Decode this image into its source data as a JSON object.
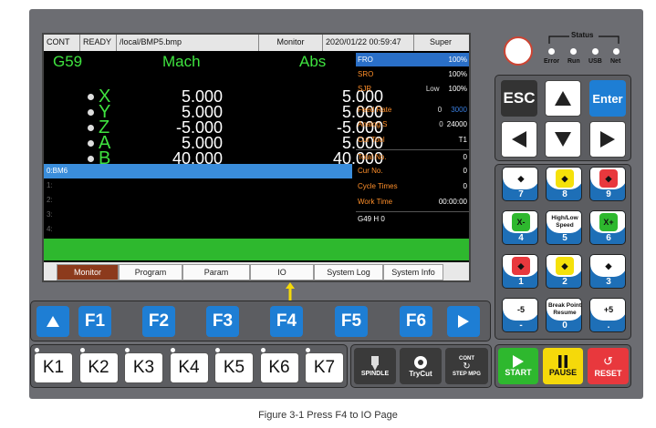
{
  "status_bar": {
    "cont": "CONT",
    "ready": "READY",
    "file": "/local/BMP5.bmp",
    "mode": "Monitor",
    "datetime": "2020/01/22 00:59:47",
    "user": "Super"
  },
  "coords": {
    "wcs": "G59",
    "mach_label": "Mach",
    "abs_label": "Abs",
    "axes": [
      {
        "name": "X",
        "mach": "5.000",
        "abs": "5.000"
      },
      {
        "name": "Y",
        "mach": "5.000",
        "abs": "5.000"
      },
      {
        "name": "Z",
        "mach": "-5.000",
        "abs": "-5.000"
      },
      {
        "name": "A",
        "mach": "5.000",
        "abs": "5.000"
      },
      {
        "name": "B",
        "mach": "40.000",
        "abs": "40.000"
      }
    ]
  },
  "right_panel": {
    "fro_label": "FRO",
    "fro": "100%",
    "sro_label": "SRO",
    "sro": "100%",
    "sjr_label": "SJR",
    "sjr_mode": "Low",
    "sjr": "100%",
    "feed_label": "Feed Rate",
    "feed_act": "0",
    "feed_set": "3000",
    "analog_label": "Analog S",
    "analog_act": "0",
    "analog_set": "24000",
    "tool_label": "Cur Tool",
    "tool": "T1",
    "total_label": "Total No.",
    "total": "0",
    "cur_label": "Cur No.",
    "cur": "0",
    "cycle_label": "Cycle Times",
    "cycle": "0",
    "work_label": "Work Time",
    "work": "00:00:00",
    "gcode": "G49 H 0"
  },
  "program": {
    "lines": [
      "0:BM6",
      "1:",
      "2:",
      "3:",
      "4:"
    ]
  },
  "tabs": [
    "Monitor",
    "Program",
    "Param",
    "IO",
    "System Log",
    "System Info"
  ],
  "status_panel": {
    "title": "Status",
    "leds": [
      "Error",
      "Run",
      "USB",
      "Net"
    ]
  },
  "nav": {
    "esc": "ESC",
    "enter": "Enter"
  },
  "jog": [
    {
      "n": "7",
      "icon": "x-minus-y-plus",
      "color": "#fff"
    },
    {
      "n": "8",
      "icon": "y-plus",
      "color": "#f5e10a"
    },
    {
      "n": "9",
      "icon": "x-plus-y-plus",
      "color": "#e8383d"
    },
    {
      "n": "4",
      "icon": "x-minus",
      "color": "#2eb82e",
      "txt": "X-"
    },
    {
      "n": "5",
      "txt": "High/Low Speed",
      "color": "#fff"
    },
    {
      "n": "6",
      "icon": "x-plus",
      "color": "#2eb82e",
      "txt": "X+"
    },
    {
      "n": "1",
      "icon": "x-minus-y-minus",
      "color": "#e8383d"
    },
    {
      "n": "2",
      "icon": "y-minus",
      "color": "#f5e10a"
    },
    {
      "n": "3",
      "icon": "x-plus-y-minus",
      "color": "#fff"
    },
    {
      "n": "-",
      "icon": "axis5-minus",
      "txt": "-5",
      "color": "#fff"
    },
    {
      "n": "0",
      "txt": "Break Point Resume",
      "color": "#fff"
    },
    {
      "n": ".",
      "icon": "axis5-plus",
      "txt": "+5",
      "color": "#fff"
    }
  ],
  "fkeys": [
    "F1",
    "F2",
    "F3",
    "F4",
    "F5",
    "F6"
  ],
  "kkeys": [
    "K1",
    "K2",
    "K3",
    "K4",
    "K5",
    "K6",
    "K7"
  ],
  "aux": {
    "spindle": "SPINDLE",
    "trycut": "TryCut",
    "cont": "CONT",
    "stepmpg": "STEP MPG",
    "start": "START",
    "pause": "PAUSE",
    "reset": "RESET"
  },
  "caption": "Figure 3-1      Press F4 to IO Page"
}
